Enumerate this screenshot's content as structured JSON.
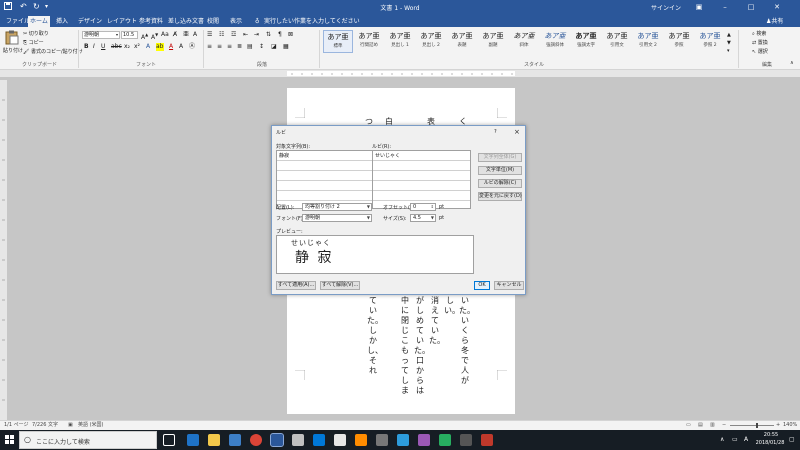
{
  "window": {
    "title": "文書 1 - Word",
    "signin": "サインイン"
  },
  "tabs": [
    "ファイル",
    "ホーム",
    "挿入",
    "デザイン",
    "レイアウト",
    "参考資料",
    "差し込み文書",
    "校閲",
    "表示"
  ],
  "tell_me": "実行したい作業を入力してください",
  "share": "共有",
  "ribbon": {
    "clipboard": {
      "paste": "貼り付け",
      "cut": "切り取り",
      "copy": "コピー",
      "format_painter": "書式のコピー/貼り付け",
      "label": "クリップボード"
    },
    "font": {
      "name": "游明朝",
      "size": "10.5",
      "label": "フォント"
    },
    "paragraph": {
      "label": "段落"
    },
    "styles": {
      "label": "スタイル",
      "preview": "あア亜",
      "items": [
        "標準",
        "行間詰め",
        "見出し 1",
        "見出し 2",
        "表題",
        "副題",
        "斜体",
        "強調斜体",
        "強調太字",
        "引用文",
        "引用文 2",
        "参照",
        "参照 2"
      ]
    },
    "editing": {
      "find": "検索",
      "replace": "置換",
      "select": "選択",
      "label": "編集"
    }
  },
  "document": {
    "columns": [
      "いた。いくら冬で人が",
      "しい。",
      "消えていた。",
      "がしめていた。口からは",
      "中に閉じこもってしま",
      "ていた。しかし、それ"
    ],
    "top_fragment": [
      "つ",
      "白",
      "表",
      "く"
    ]
  },
  "dialog": {
    "title": "ルビ",
    "help": "?",
    "close": "×",
    "target_label": "対象文字列(B):",
    "ruby_label": "ルビ(R):",
    "target_value": "静寂",
    "ruby_value": "せいじゃく",
    "buttons": {
      "group_all": "文字列全体(G)",
      "per_char": "文字単位(M)",
      "remove": "ルビの解除(C)",
      "restore": "変更を元に戻す(D)",
      "apply_all": "すべて適用(A)...",
      "remove_all": "すべて解除(V)...",
      "ok": "OK",
      "cancel": "キャンセル"
    },
    "alignment_label": "配置(L):",
    "alignment_value": "均等割り付け 2",
    "offset_label": "オフセット(O):",
    "offset_value": "0",
    "offset_unit": "pt",
    "font_label": "フォント(F):",
    "font_value": "游明朝",
    "size_label": "サイズ(S):",
    "size_value": "4.5",
    "size_unit": "pt",
    "preview_label": "プレビュー:",
    "preview_ruby": "せいじゃく",
    "preview_base": "静 寂"
  },
  "status": {
    "page": "1/1 ページ",
    "words": "7/226 文字",
    "lang": "英語 (米国)",
    "zoom": "140%"
  },
  "taskbar": {
    "search": "ここに入力して検索",
    "time": "20:55",
    "date": "2018/01/28"
  },
  "colors": {
    "accent": "#2b579a",
    "taskbar": "#161d24",
    "ribbon": "#f3f3f3"
  }
}
